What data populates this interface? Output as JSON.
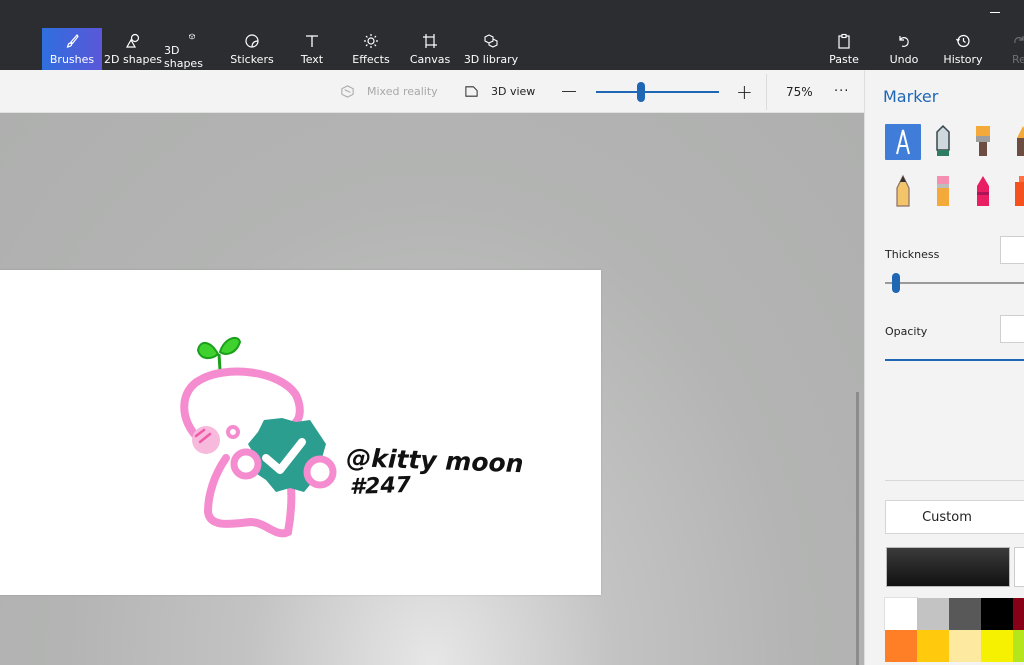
{
  "toolbar": {
    "tools": [
      {
        "label": "Brushes",
        "icon": "brush-icon"
      },
      {
        "label": "2D shapes",
        "icon": "2d-shapes-icon"
      },
      {
        "label": "3D shapes",
        "icon": "3d-shapes-icon"
      },
      {
        "label": "Stickers",
        "icon": "stickers-icon"
      },
      {
        "label": "Text",
        "icon": "text-icon"
      },
      {
        "label": "Effects",
        "icon": "effects-icon"
      },
      {
        "label": "Canvas",
        "icon": "canvas-icon"
      },
      {
        "label": "3D library",
        "icon": "3d-library-icon"
      }
    ],
    "right_tools": [
      {
        "label": "Paste",
        "icon": "paste-icon"
      },
      {
        "label": "Undo",
        "icon": "undo-icon"
      },
      {
        "label": "History",
        "icon": "history-icon"
      },
      {
        "label": "Re",
        "icon": "redo-icon"
      }
    ],
    "active_tool": "Brushes"
  },
  "subbar": {
    "mixed_reality": "Mixed reality",
    "view_3d": "3D view",
    "zoom_out": "—",
    "zoom_in": "+",
    "zoom_level": "75%",
    "more": "···"
  },
  "canvas": {
    "handle": "@kitty moon",
    "number": "#247"
  },
  "panel": {
    "title": "Marker",
    "thickness_label": "Thickness",
    "opacity_label": "Opacity",
    "custom_label": "Custom"
  },
  "palette": {
    "row1": [
      "#ffffff",
      "#c3c3c3",
      "#585858",
      "#000000",
      "#880015"
    ],
    "row2": [
      "#ff7f27",
      "#ffc90e",
      "#fde9a0",
      "#f6f100",
      "#b5e61d"
    ],
    "current": "#1f1f1f"
  },
  "colors": {
    "accent": "#1f66b5",
    "topbar": "#2b2d31",
    "pink": "#f48ccf",
    "teal": "#2b9e8f",
    "sprout": "#3fd12e"
  }
}
